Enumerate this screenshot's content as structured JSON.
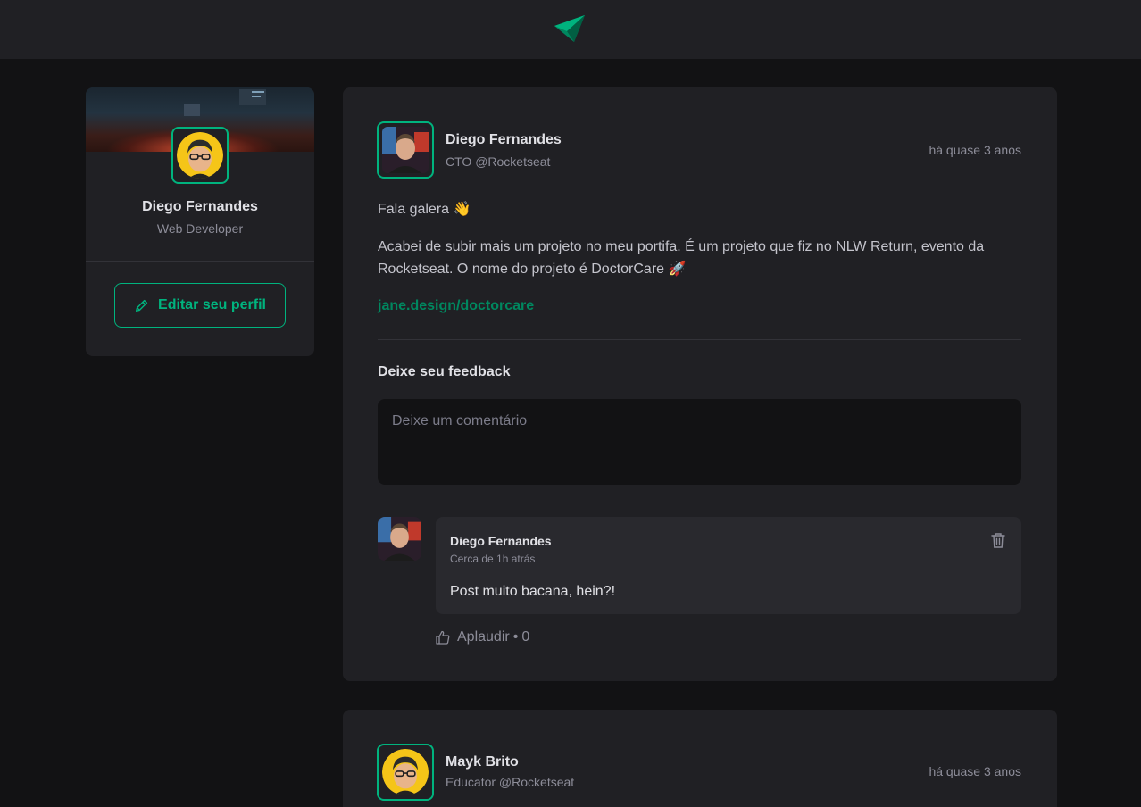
{
  "header": {
    "logo_icon": "ignite-feed-logo-icon"
  },
  "colors": {
    "brand": "#00b37e",
    "brand_dark": "#00875f",
    "background": "#121214",
    "surface": "#202024"
  },
  "sidebar": {
    "name": "Diego Fernandes",
    "role": "Web Developer",
    "edit_button_label": "Editar seu perfil",
    "edit_icon": "pencil-icon"
  },
  "posts": [
    {
      "author": {
        "name": "Diego Fernandes",
        "role": "CTO @Rocketseat"
      },
      "published_at": "há quase 3 anos",
      "content": {
        "paragraph_1": "Fala galera 👋",
        "paragraph_2": "Acabei de subir mais um projeto no meu portifa. É um projeto que fiz no NLW Return, evento da Rocketseat. O nome do projeto é DoctorCare 🚀",
        "link": "jane.design/doctorcare"
      },
      "feedback": {
        "title": "Deixe seu feedback",
        "placeholder": "Deixe um comentário"
      },
      "comments": [
        {
          "author": "Diego Fernandes",
          "time": "Cerca de 1h atrás",
          "text": "Post muito bacana, hein?!",
          "delete_icon": "trash-icon",
          "applaud_label": "Aplaudir",
          "applaud_separator": "•",
          "applaud_count": "0"
        }
      ]
    },
    {
      "author": {
        "name": "Mayk Brito",
        "role": "Educator @Rocketseat"
      },
      "published_at": "há quase 3 anos"
    }
  ]
}
